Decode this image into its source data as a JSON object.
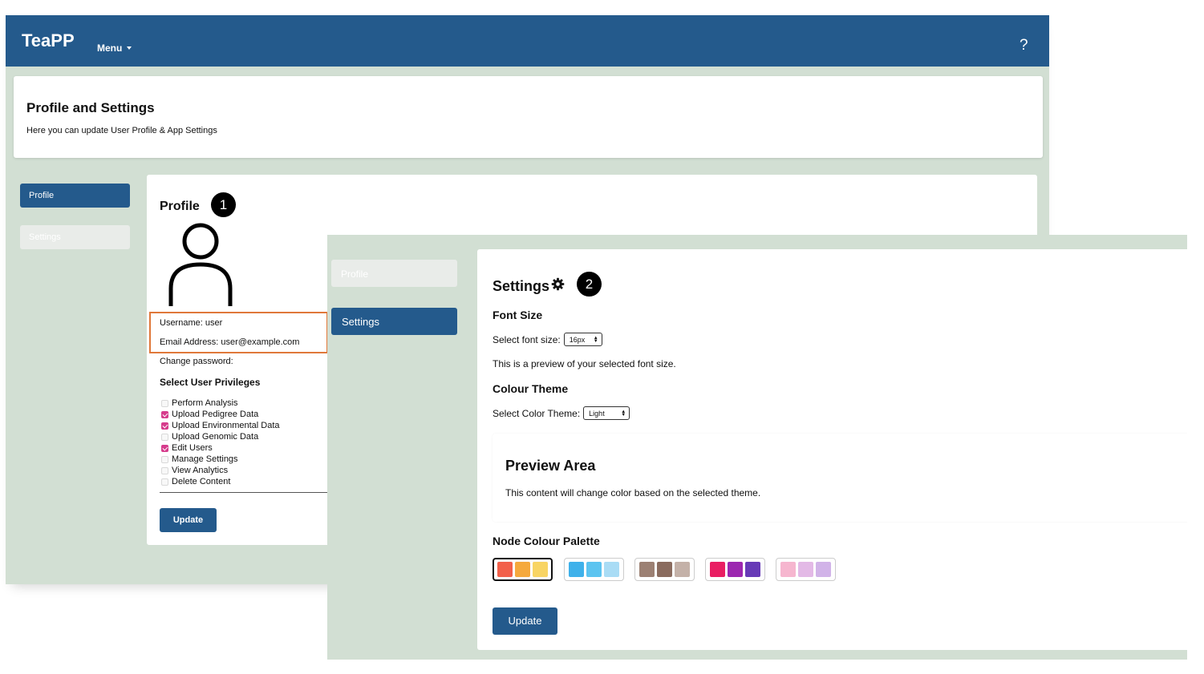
{
  "app": {
    "title": "TeaPP",
    "menu_label": "Menu",
    "help_label": "?"
  },
  "header": {
    "title": "Profile and Settings",
    "subtitle": "Here you can update User Profile & App Settings"
  },
  "profile_window": {
    "sidebar": [
      {
        "label": "Profile",
        "active": true
      },
      {
        "label": "Settings",
        "active": false
      }
    ],
    "heading": "Profile",
    "badge": "1",
    "username_line": "Username: user",
    "email_line": "Email Address: user@example.com",
    "change_password_line": "Change password:",
    "privileges_title": "Select User Privileges",
    "privileges": [
      {
        "label": "Perform Analysis",
        "checked": false
      },
      {
        "label": "Upload Pedigree Data",
        "checked": true
      },
      {
        "label": "Upload Environmental Data",
        "checked": true
      },
      {
        "label": "Upload Genomic Data",
        "checked": false
      },
      {
        "label": "Edit Users",
        "checked": true
      },
      {
        "label": "Manage Settings",
        "checked": false
      },
      {
        "label": "View Analytics",
        "checked": false
      },
      {
        "label": "Delete Content",
        "checked": false
      }
    ],
    "update_label": "Update"
  },
  "settings_window": {
    "sidebar": [
      {
        "label": "Profile",
        "active": false
      },
      {
        "label": "Settings",
        "active": true
      }
    ],
    "heading": "Settings",
    "badge": "2",
    "font_size_title": "Font Size",
    "font_size_label": "Select font size:",
    "font_size_value": "16px",
    "font_preview_text": "This is a preview of your selected font size.",
    "colour_theme_title": "Colour Theme",
    "colour_theme_label": "Select Color Theme:",
    "colour_theme_value": "Light",
    "preview_title": "Preview Area",
    "preview_text": "This content will change color based on the selected theme.",
    "palette_title": "Node Colour Palette",
    "palettes": [
      {
        "colors": [
          "#f2604a",
          "#f5a93c",
          "#f8d463"
        ],
        "selected": true
      },
      {
        "colors": [
          "#3fb1ea",
          "#5cc4f0",
          "#a9dcf5"
        ],
        "selected": false
      },
      {
        "colors": [
          "#9c8073",
          "#8a6b5e",
          "#c4b1a8"
        ],
        "selected": false
      },
      {
        "colors": [
          "#e91e63",
          "#9c27b0",
          "#673ab7"
        ],
        "selected": false
      },
      {
        "colors": [
          "#f6b6cf",
          "#e3b9e6",
          "#d1b3e8"
        ],
        "selected": false
      }
    ],
    "update_label": "Update"
  },
  "colors": {
    "accent": "#245a8c",
    "background": "#d2dfd3",
    "highlight": "#e0783a",
    "checkbox_checked": "#d63c8c"
  }
}
